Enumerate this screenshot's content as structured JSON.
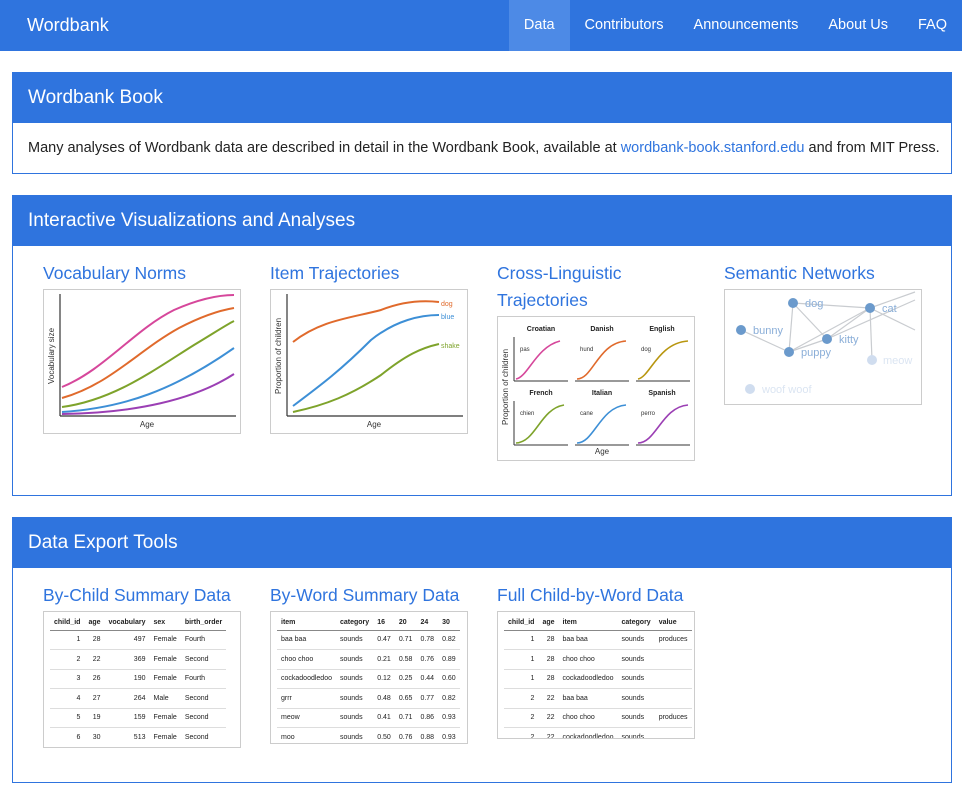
{
  "nav": {
    "brand": "Wordbank",
    "items": [
      "Data",
      "Contributors",
      "Announcements",
      "About Us",
      "FAQ"
    ]
  },
  "book": {
    "title": "Wordbank Book",
    "text_before": "Many analyses of Wordbank data are described in detail in the Wordbank Book, available at ",
    "link": "wordbank-book.stanford.edu",
    "text_after": " and from MIT Press."
  },
  "viz": {
    "title": "Interactive Visualizations and Analyses",
    "tiles": [
      {
        "title": "Vocabulary Norms",
        "xlabel": "Age",
        "ylabel": "Vocabulary size"
      },
      {
        "title": "Item Trajectories",
        "xlabel": "Age",
        "ylabel": "Proportion of children",
        "series": [
          "dog",
          "blue",
          "shake"
        ]
      },
      {
        "title": "Cross-Linguistic Trajectories",
        "xlabel": "Age",
        "ylabel": "Proportion of children",
        "panels": [
          {
            "lang": "Croatian",
            "word": "pas"
          },
          {
            "lang": "Danish",
            "word": "hund"
          },
          {
            "lang": "English",
            "word": "dog"
          },
          {
            "lang": "French",
            "word": "chien"
          },
          {
            "lang": "Italian",
            "word": "cane"
          },
          {
            "lang": "Spanish",
            "word": "perro"
          }
        ]
      },
      {
        "title": "Semantic Networks",
        "nodes": [
          "dog",
          "cat",
          "bunny",
          "kitty",
          "puppy",
          "meow",
          "woof woof"
        ]
      }
    ]
  },
  "export": {
    "title": "Data Export Tools",
    "tiles": [
      {
        "title": "By-Child Summary Data",
        "columns": [
          "child_id",
          "age",
          "vocabulary",
          "sex",
          "birth_order"
        ],
        "rows": [
          [
            "1",
            "28",
            "497",
            "Female",
            "Fourth"
          ],
          [
            "2",
            "22",
            "369",
            "Female",
            "Second"
          ],
          [
            "3",
            "26",
            "190",
            "Female",
            "Fourth"
          ],
          [
            "4",
            "27",
            "264",
            "Male",
            "Second"
          ],
          [
            "5",
            "19",
            "159",
            "Female",
            "Second"
          ],
          [
            "6",
            "30",
            "513",
            "Female",
            "Second"
          ]
        ]
      },
      {
        "title": "By-Word Summary Data",
        "columns": [
          "item",
          "category",
          "16",
          "20",
          "24",
          "30"
        ],
        "rows": [
          [
            "baa baa",
            "sounds",
            "0.47",
            "0.71",
            "0.78",
            "0.82"
          ],
          [
            "choo choo",
            "sounds",
            "0.21",
            "0.58",
            "0.76",
            "0.89"
          ],
          [
            "cockadoodledoo",
            "sounds",
            "0.12",
            "0.25",
            "0.44",
            "0.60"
          ],
          [
            "grrr",
            "sounds",
            "0.48",
            "0.65",
            "0.77",
            "0.82"
          ],
          [
            "meow",
            "sounds",
            "0.41",
            "0.71",
            "0.86",
            "0.93"
          ],
          [
            "moo",
            "sounds",
            "0.50",
            "0.76",
            "0.88",
            "0.93"
          ]
        ]
      },
      {
        "title": "Full Child-by-Word Data",
        "columns": [
          "child_id",
          "age",
          "item",
          "category",
          "value"
        ],
        "rows": [
          [
            "1",
            "28",
            "baa baa",
            "sounds",
            "produces"
          ],
          [
            "1",
            "28",
            "choo choo",
            "sounds",
            ""
          ],
          [
            "1",
            "28",
            "cockadoodledoo",
            "sounds",
            ""
          ],
          [
            "2",
            "22",
            "baa baa",
            "sounds",
            ""
          ],
          [
            "2",
            "22",
            "choo choo",
            "sounds",
            "produces"
          ],
          [
            "2",
            "22",
            "cockadoodledoo",
            "sounds",
            ""
          ]
        ]
      }
    ]
  },
  "colors": {
    "brand": "#2f74de",
    "pink": "#d6479b",
    "orange": "#e06a2c",
    "green": "#7ea32b",
    "blue": "#3d8fd6",
    "purple": "#9b3fb4"
  }
}
